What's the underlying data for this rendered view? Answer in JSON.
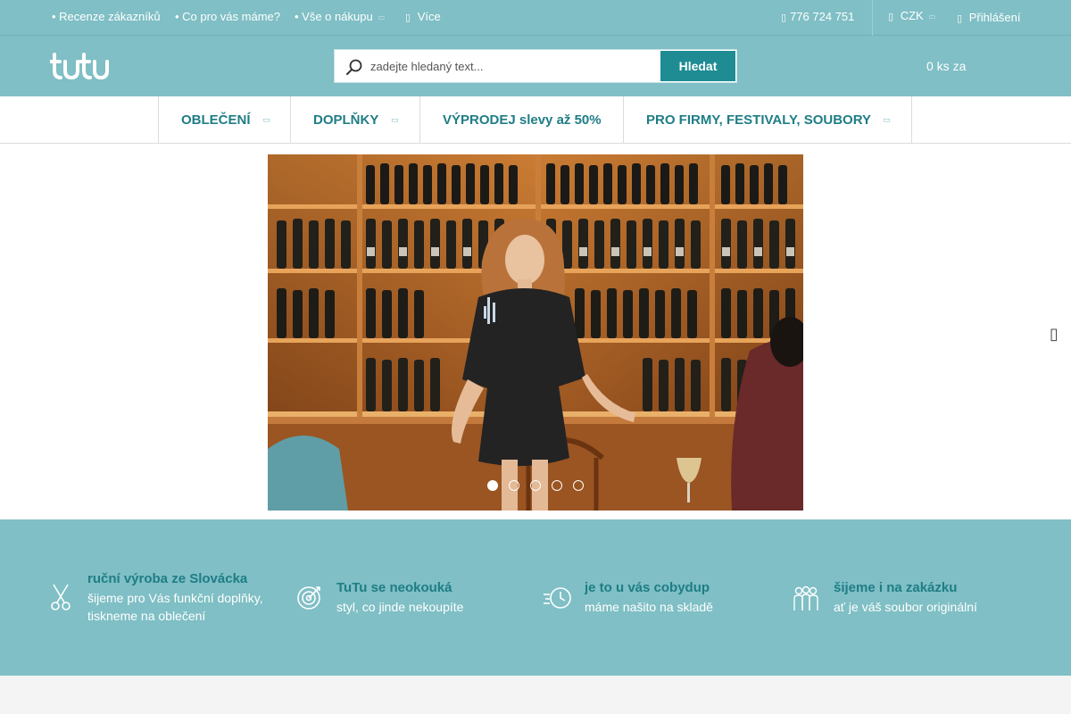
{
  "topbar": {
    "links": [
      "• Recenze zákazníků",
      "• Co pro vás máme?",
      "• Vše o nákupu"
    ],
    "more_label": "Více",
    "phone": "776 724 751",
    "currency": "CZK",
    "login": "Přihlášení"
  },
  "header": {
    "search_placeholder": "zadejte hledaný text...",
    "search_button": "Hledat",
    "cart_text": "0 ks za"
  },
  "nav": {
    "items": [
      "OBLEČENÍ",
      "DOPLŇKY",
      "VÝPRODEJ slevy až 50%",
      "PRO FIRMY, FESTIVALY, SOUBORY"
    ]
  },
  "carousel": {
    "slide_count": 5,
    "active_index": 0
  },
  "features": [
    {
      "title": "ruční výroba ze Slovácka",
      "text": "šijeme pro Vás funkční doplňky, tiskneme na oblečení",
      "icon": "scissors-icon"
    },
    {
      "title": "TuTu se neokouká",
      "text": "styl, co jinde nekoupíte",
      "icon": "target-icon"
    },
    {
      "title": "je to u vás cobydup",
      "text": "máme našito na skladě",
      "icon": "fast-clock-icon"
    },
    {
      "title": "šijeme i na zakázku",
      "text": "ať je váš soubor originální",
      "icon": "group-icon"
    }
  ],
  "colors": {
    "header_bg": "#7fbfc5",
    "accent": "#1f7d86",
    "button": "#1f8c94"
  }
}
